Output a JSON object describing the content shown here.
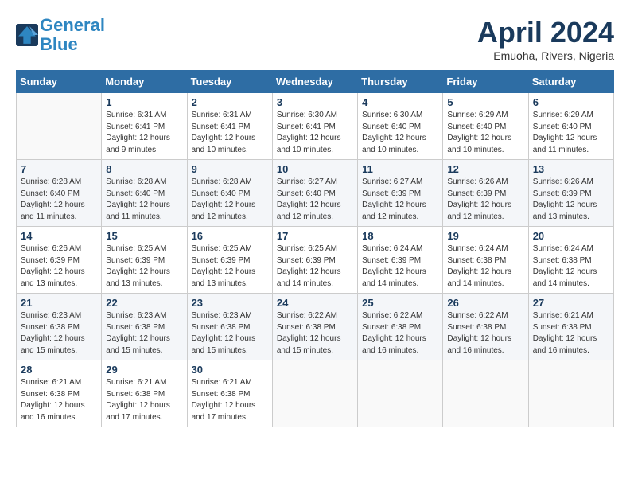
{
  "header": {
    "logo_line1": "General",
    "logo_line2": "Blue",
    "month_title": "April 2024",
    "location": "Emuoha, Rivers, Nigeria"
  },
  "weekdays": [
    "Sunday",
    "Monday",
    "Tuesday",
    "Wednesday",
    "Thursday",
    "Friday",
    "Saturday"
  ],
  "weeks": [
    [
      {
        "day": "",
        "info": ""
      },
      {
        "day": "1",
        "info": "Sunrise: 6:31 AM\nSunset: 6:41 PM\nDaylight: 12 hours\nand 9 minutes."
      },
      {
        "day": "2",
        "info": "Sunrise: 6:31 AM\nSunset: 6:41 PM\nDaylight: 12 hours\nand 10 minutes."
      },
      {
        "day": "3",
        "info": "Sunrise: 6:30 AM\nSunset: 6:41 PM\nDaylight: 12 hours\nand 10 minutes."
      },
      {
        "day": "4",
        "info": "Sunrise: 6:30 AM\nSunset: 6:40 PM\nDaylight: 12 hours\nand 10 minutes."
      },
      {
        "day": "5",
        "info": "Sunrise: 6:29 AM\nSunset: 6:40 PM\nDaylight: 12 hours\nand 10 minutes."
      },
      {
        "day": "6",
        "info": "Sunrise: 6:29 AM\nSunset: 6:40 PM\nDaylight: 12 hours\nand 11 minutes."
      }
    ],
    [
      {
        "day": "7",
        "info": "Sunrise: 6:28 AM\nSunset: 6:40 PM\nDaylight: 12 hours\nand 11 minutes."
      },
      {
        "day": "8",
        "info": "Sunrise: 6:28 AM\nSunset: 6:40 PM\nDaylight: 12 hours\nand 11 minutes."
      },
      {
        "day": "9",
        "info": "Sunrise: 6:28 AM\nSunset: 6:40 PM\nDaylight: 12 hours\nand 12 minutes."
      },
      {
        "day": "10",
        "info": "Sunrise: 6:27 AM\nSunset: 6:40 PM\nDaylight: 12 hours\nand 12 minutes."
      },
      {
        "day": "11",
        "info": "Sunrise: 6:27 AM\nSunset: 6:39 PM\nDaylight: 12 hours\nand 12 minutes."
      },
      {
        "day": "12",
        "info": "Sunrise: 6:26 AM\nSunset: 6:39 PM\nDaylight: 12 hours\nand 12 minutes."
      },
      {
        "day": "13",
        "info": "Sunrise: 6:26 AM\nSunset: 6:39 PM\nDaylight: 12 hours\nand 13 minutes."
      }
    ],
    [
      {
        "day": "14",
        "info": "Sunrise: 6:26 AM\nSunset: 6:39 PM\nDaylight: 12 hours\nand 13 minutes."
      },
      {
        "day": "15",
        "info": "Sunrise: 6:25 AM\nSunset: 6:39 PM\nDaylight: 12 hours\nand 13 minutes."
      },
      {
        "day": "16",
        "info": "Sunrise: 6:25 AM\nSunset: 6:39 PM\nDaylight: 12 hours\nand 13 minutes."
      },
      {
        "day": "17",
        "info": "Sunrise: 6:25 AM\nSunset: 6:39 PM\nDaylight: 12 hours\nand 14 minutes."
      },
      {
        "day": "18",
        "info": "Sunrise: 6:24 AM\nSunset: 6:39 PM\nDaylight: 12 hours\nand 14 minutes."
      },
      {
        "day": "19",
        "info": "Sunrise: 6:24 AM\nSunset: 6:38 PM\nDaylight: 12 hours\nand 14 minutes."
      },
      {
        "day": "20",
        "info": "Sunrise: 6:24 AM\nSunset: 6:38 PM\nDaylight: 12 hours\nand 14 minutes."
      }
    ],
    [
      {
        "day": "21",
        "info": "Sunrise: 6:23 AM\nSunset: 6:38 PM\nDaylight: 12 hours\nand 15 minutes."
      },
      {
        "day": "22",
        "info": "Sunrise: 6:23 AM\nSunset: 6:38 PM\nDaylight: 12 hours\nand 15 minutes."
      },
      {
        "day": "23",
        "info": "Sunrise: 6:23 AM\nSunset: 6:38 PM\nDaylight: 12 hours\nand 15 minutes."
      },
      {
        "day": "24",
        "info": "Sunrise: 6:22 AM\nSunset: 6:38 PM\nDaylight: 12 hours\nand 15 minutes."
      },
      {
        "day": "25",
        "info": "Sunrise: 6:22 AM\nSunset: 6:38 PM\nDaylight: 12 hours\nand 16 minutes."
      },
      {
        "day": "26",
        "info": "Sunrise: 6:22 AM\nSunset: 6:38 PM\nDaylight: 12 hours\nand 16 minutes."
      },
      {
        "day": "27",
        "info": "Sunrise: 6:21 AM\nSunset: 6:38 PM\nDaylight: 12 hours\nand 16 minutes."
      }
    ],
    [
      {
        "day": "28",
        "info": "Sunrise: 6:21 AM\nSunset: 6:38 PM\nDaylight: 12 hours\nand 16 minutes."
      },
      {
        "day": "29",
        "info": "Sunrise: 6:21 AM\nSunset: 6:38 PM\nDaylight: 12 hours\nand 17 minutes."
      },
      {
        "day": "30",
        "info": "Sunrise: 6:21 AM\nSunset: 6:38 PM\nDaylight: 12 hours\nand 17 minutes."
      },
      {
        "day": "",
        "info": ""
      },
      {
        "day": "",
        "info": ""
      },
      {
        "day": "",
        "info": ""
      },
      {
        "day": "",
        "info": ""
      }
    ]
  ]
}
